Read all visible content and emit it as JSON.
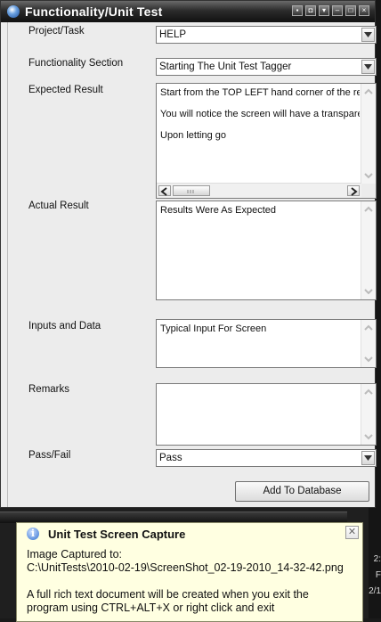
{
  "window": {
    "title": "Functionality/Unit Test",
    "title_buttons": [
      "pin",
      "dock",
      "restore-down",
      "minimize",
      "maximize",
      "close"
    ]
  },
  "form": {
    "project_label": "Project/Task",
    "project_value": "HELP",
    "section_label": "Functionality Section",
    "section_value": "Starting The Unit Test Tagger",
    "expected_label": "Expected Result",
    "expected_lines": [
      "Start from the TOP LEFT hand corner of the reg",
      "You will notice the screen will have a transparer",
      "Upon letting go"
    ],
    "actual_label": "Actual Result",
    "actual_value": "Results Were As Expected",
    "inputs_label": "Inputs and Data",
    "inputs_value": "Typical Input For Screen",
    "remarks_label": "Remarks",
    "remarks_value": "",
    "pass_label": "Pass/Fail",
    "pass_value": "Pass",
    "add_button": "Add To Database"
  },
  "notification": {
    "title": "Unit Test Screen Capture",
    "line1": "Image Captured to:",
    "line2": "C:\\UnitTests\\2010-02-19\\ScreenShot_02-19-2010_14-32-42.png",
    "line3": "A full rich text document will be created when you exit the",
    "line4": "program using CTRL+ALT+X or right click and exit",
    "icon": "info-icon",
    "close_glyph": "✕"
  },
  "taskbar": {
    "clock_fragments": [
      "2:",
      "F",
      "2/1"
    ]
  },
  "colors": {
    "balloon_bg": "#ffffe1",
    "window_bg": "#ececec",
    "titlebar": "#2c2c2c"
  }
}
